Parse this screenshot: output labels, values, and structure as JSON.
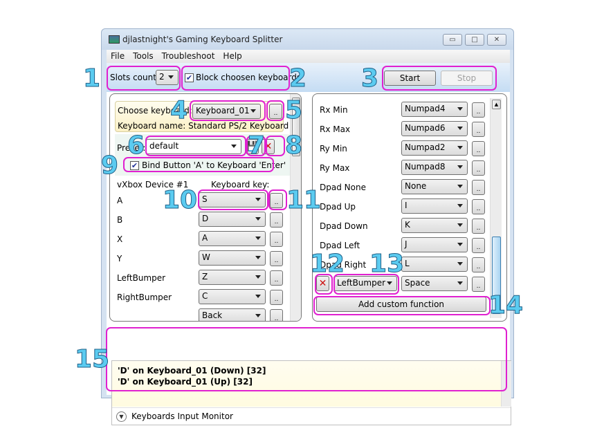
{
  "window": {
    "title": "djlastnight's Gaming Keyboard Splitter",
    "controls": {
      "minimize": "▭",
      "maximize": "□",
      "close": "✕"
    }
  },
  "menu": [
    "File",
    "Tools",
    "Troubleshoot",
    "Help"
  ],
  "toolbar": {
    "slots_label": "Slots count:",
    "slots_value": "2",
    "block_checked": true,
    "block_label": "Block choosen keyboards",
    "start_label": "Start",
    "stop_label": "Stop"
  },
  "left_panel": {
    "choose_keyboard_label": "Choose keyboard:",
    "keyboard_value": "Keyboard_01",
    "keyboard_name": "Keyboard name: Standard PS/2 Keyboard",
    "preset_label": "Preset:",
    "preset_value": "default",
    "bind_checked": true,
    "bind_label": "Bind Button 'A' to Keyboard 'Enter'",
    "device_header": "vXbox Device #1",
    "key_header": "Keyboard key:",
    "more_label": "..",
    "mappings": [
      {
        "button": "A",
        "key": "S"
      },
      {
        "button": "B",
        "key": "D"
      },
      {
        "button": "X",
        "key": "A"
      },
      {
        "button": "Y",
        "key": "W"
      },
      {
        "button": "LeftBumper",
        "key": "Z"
      },
      {
        "button": "RightBumper",
        "key": "C"
      },
      {
        "button": "",
        "key": "Back"
      }
    ]
  },
  "right_panel": {
    "more_label": "..",
    "mappings": [
      {
        "button": "Rx Min",
        "key": "Numpad4"
      },
      {
        "button": "Rx Max",
        "key": "Numpad6"
      },
      {
        "button": "Ry Min",
        "key": "Numpad2"
      },
      {
        "button": "Ry Max",
        "key": "Numpad8"
      },
      {
        "button": "Dpad None",
        "key": "None"
      },
      {
        "button": "Dpad Up",
        "key": "I"
      },
      {
        "button": "Dpad Down",
        "key": "K"
      },
      {
        "button": "Dpad Left",
        "key": "J"
      },
      {
        "button": "Dpad Right",
        "key": "L"
      }
    ],
    "custom_function": {
      "button": "LeftBumper",
      "key": "Space"
    },
    "add_custom_label": "Add custom function"
  },
  "monitor": {
    "lines": [
      "'D' on Keyboard_01 (Down) [32]",
      "'D' on Keyboard_01 (Up) [32]"
    ],
    "title": "Keyboards Input Monitor"
  },
  "callouts": [
    "1",
    "2",
    "3",
    "4",
    "5",
    "6",
    "7",
    "8",
    "9",
    "10",
    "11",
    "12",
    "13",
    "14",
    "15"
  ],
  "colors": {
    "callout": "#e020d0",
    "number": "#5bcbf0",
    "delete": "#cc1111"
  }
}
